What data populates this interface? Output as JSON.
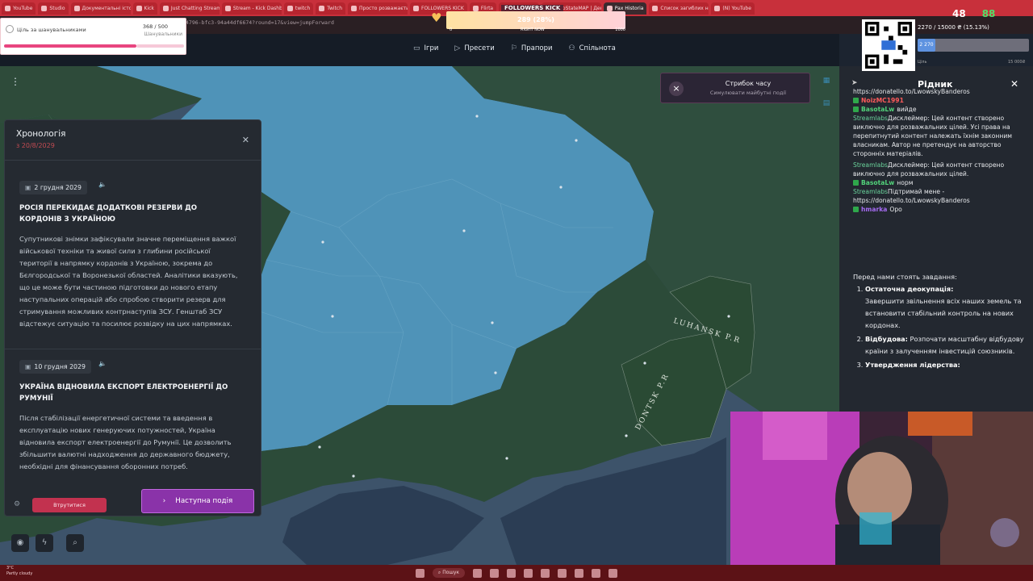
{
  "browser": {
    "tabs": [
      {
        "label": "YouTube"
      },
      {
        "label": "Studio"
      },
      {
        "label": "Документальні історії"
      },
      {
        "label": "Kick"
      },
      {
        "label": "Just Chatting Streaming"
      },
      {
        "label": "Stream - Kick Dashboard"
      },
      {
        "label": "twitch"
      },
      {
        "label": "Twitch"
      },
      {
        "label": "Просто розважається в чат"
      },
      {
        "label": "FOLLOWERS KICK"
      },
      {
        "label": "Flirta"
      },
      {
        "label": "DeepState"
      },
      {
        "label": "DeepStateMAP | День 14"
      },
      {
        "label": "Pax Historia"
      },
      {
        "label": "Список загиблих на війні"
      },
      {
        "label": "(N) YouTube"
      }
    ],
    "active_tab_index": 13,
    "address": "4796-bfc3-94a44df6674?round=17&view=jumpForward"
  },
  "goal_widget": {
    "label": "Ціль за шанувальниками",
    "count": "368 / 500",
    "sub": "Шанувальники",
    "progress": 0.736
  },
  "followers_bar": {
    "title": "FOLLOWERS KICK",
    "value": "289 (28%)",
    "progress": 0.28,
    "min": "0",
    "mid": "RIGHT NOW",
    "max": "1000"
  },
  "qr_widget": {
    "text": "2270 / 15000 ₴ (15.13%)",
    "bar_value": "2 270",
    "sub_left": "Ціль",
    "sub_right": "15 000₴",
    "progress": 0.1513
  },
  "stream_stats": {
    "viewers": "48",
    "kick": "88"
  },
  "app_nav": [
    {
      "label": "Ігри",
      "icon": "gamepad-icon"
    },
    {
      "label": "Пресети",
      "icon": "play-icon"
    },
    {
      "label": "Прапори",
      "icon": "flag-icon"
    },
    {
      "label": "Спільнота",
      "icon": "users-icon"
    }
  ],
  "jump_panel": {
    "title": "Стрибок часу",
    "subtitle": "Симулювати майбутні події"
  },
  "chronology": {
    "title": "Хронологія",
    "date": "з 20/8/2029",
    "events": [
      {
        "date": "2 грудня 2029",
        "headline": "РОСІЯ ПЕРЕКИДАЄ ДОДАТКОВІ РЕЗЕРВИ ДО КОРДОНІВ З УКРАЇНОЮ",
        "body": "Супутникові знімки зафіксували значне переміщення важкої військової техніки та живої сили з глибини російської території в напрямку кордонів з Україною, зокрема до Бєлгородської та Воронезької областей. Аналітики вказують, що це може бути частиною підготовки до нового етапу наступальних операцій або спробою створити резерв для стримування можливих контрнаступів ЗСУ. Генштаб ЗСУ відстежує ситуацію та посилює розвідку на цих напрямках."
      },
      {
        "date": "10 грудня 2029",
        "headline": "УКРАЇНА ВІДНОВИЛА ЕКСПОРТ ЕЛЕКТРОЕНЕРГІЇ ДО РУМУНІЇ",
        "body": "Після стабілізації енергетичної системи та введення в експлуатацію нових генеруючих потужностей, Україна відновила експорт електроенергії до Румунії. Це дозволить збільшити валютні надходження до державного бюджету, необхідні для фінансування оборонних потреб."
      }
    ],
    "intervene_label": "Втрутитися",
    "next_label": "Наступна подія"
  },
  "map_labels": {
    "luhansk": "LUHANSK P.R",
    "donetsk": "DONTSK P.R"
  },
  "chat": {
    "header": "Рідник",
    "top_link": "https://donatello.to/LwowskyBanderos",
    "messages": [
      {
        "user": "NoizMC1991",
        "text": ""
      },
      {
        "user": "BasotaLw",
        "text": "вийде"
      },
      {
        "user": "Streamlabs",
        "text": "Дисклеймер: Цей контент створено виключно для розважальних цілей. Усі права на перепитнутий контент належать їхнім законним власникам. Автор не претендує на авторство сторонніх матеріалів."
      },
      {
        "user": "Streamlabs",
        "text": "Дисклеймер: Цей контент створено виключно для розважальних цілей."
      },
      {
        "user": "BasotaLw",
        "text": "норм"
      },
      {
        "user": "Streamlabs",
        "text": "Підтримай мене - https://donatello.to/LwowskyBanderos"
      },
      {
        "user": "hmarka",
        "text": "Оро"
      }
    ],
    "speech_intro": "Перед нами стоять завдання:",
    "speech_items": [
      {
        "title": "Остаточна деокупація:",
        "text": "Завершити звільнення всіх наших земель та встановити стабільний контроль на нових кордонах."
      },
      {
        "title": "Відбудова:",
        "text": "Розпочати масштабну відбудову країни з залученням інвестицій союзників."
      },
      {
        "title": "Утвердження лідерства:",
        "text": ""
      }
    ]
  },
  "taskbar": {
    "search": "Пошук",
    "weather_temp": "3°C",
    "weather_desc": "Partly cloudy"
  },
  "colors": {
    "map_water": "#3a4f63",
    "map_russia": "#4f93b8",
    "map_ukraine": "#2b4a38",
    "accent_purple": "#8a33a9",
    "accent_red": "#c2324f"
  }
}
